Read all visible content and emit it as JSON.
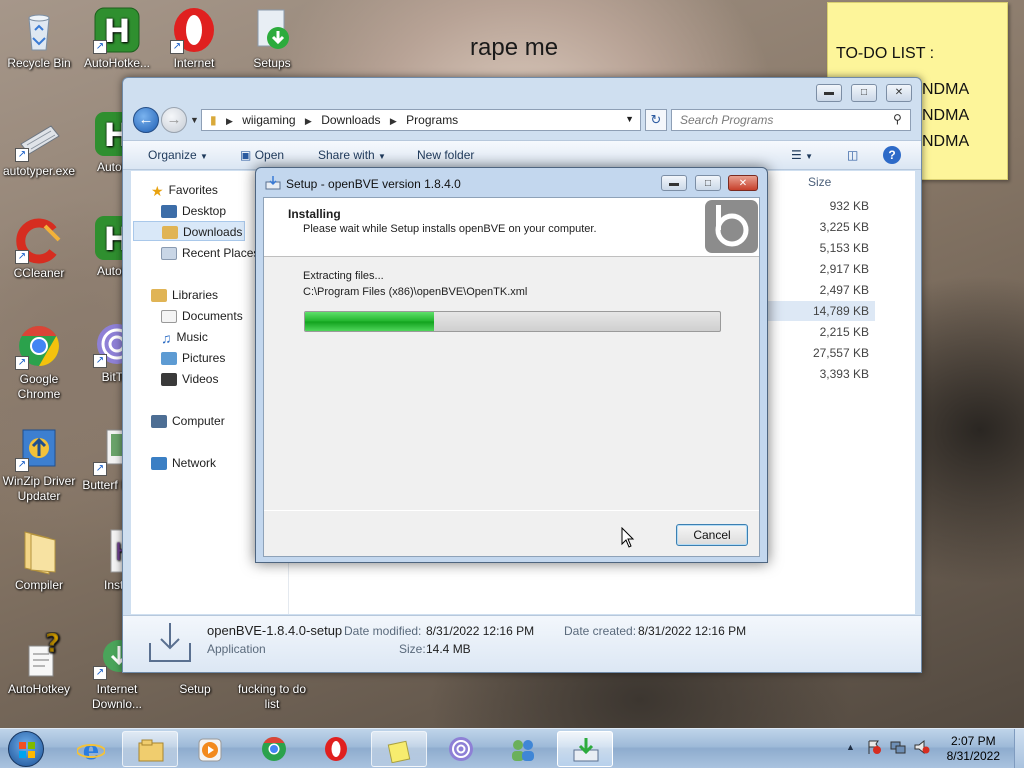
{
  "wallpaper_text": "rape me",
  "sticky_note": {
    "title": "TO-DO LIST :",
    "lines": [
      "NDMA",
      "NDMA",
      "NDMA"
    ]
  },
  "desktop_icons": [
    {
      "label": "Recycle Bin",
      "icon": "recycle-bin-icon"
    },
    {
      "label": "AutoHotke...",
      "icon": "autohotkey-icon"
    },
    {
      "label": "Internet",
      "icon": "opera-icon"
    },
    {
      "label": "Setups",
      "icon": "setups-icon"
    },
    {
      "label": "autotyper.exe",
      "icon": "keyboard-icon"
    },
    {
      "label": "AutoHo",
      "icon": "autohotkey-icon"
    },
    {
      "label": "CCleaner",
      "icon": "ccleaner-icon"
    },
    {
      "label": "AutoHo",
      "icon": "autohotkey-icon"
    },
    {
      "label": "Google Chrome",
      "icon": "chrome-icon"
    },
    {
      "label": "BitTor",
      "icon": "bittorrent-icon"
    },
    {
      "label": "WinZip Driver Updater",
      "icon": "winzip-icon"
    },
    {
      "label": "Butterf Deskt",
      "icon": "butterfly-icon"
    },
    {
      "label": "Compiler",
      "icon": "folder-icon"
    },
    {
      "label": "Insta",
      "icon": "installer-icon"
    },
    {
      "label": "AutoHotkey",
      "icon": "autohotkey-script-icon"
    },
    {
      "label": "Internet Downlo...",
      "icon": "idm-icon"
    },
    {
      "label": "Setup",
      "icon": "setup-icon"
    },
    {
      "label": "fucking to do list",
      "icon": "text-file-icon"
    }
  ],
  "explorer": {
    "breadcrumbs": [
      "wiigaming",
      "Downloads",
      "Programs"
    ],
    "search_placeholder": "Search Programs",
    "toolbar": {
      "organize": "Organize",
      "open": "Open",
      "share_with": "Share with",
      "new_folder": "New folder"
    },
    "nav": {
      "favorites": "Favorites",
      "favorite_items": [
        "Desktop",
        "Downloads",
        "Recent Places"
      ],
      "libraries": "Libraries",
      "library_items": [
        "Documents",
        "Music",
        "Pictures",
        "Videos"
      ],
      "computer": "Computer",
      "network": "Network"
    },
    "column_size": "Size",
    "sizes": [
      "932 KB",
      "3,225 KB",
      "5,153 KB",
      "2,917 KB",
      "2,497 KB",
      "14,789 KB",
      "2,215 KB",
      "27,557 KB",
      "3,393 KB"
    ],
    "details": {
      "name": "openBVE-1.8.4.0-setup",
      "type": "Application",
      "date_modified_label": "Date modified:",
      "date_modified": "8/31/2022 12:16 PM",
      "date_created_label": "Date created:",
      "date_created": "8/31/2022 12:16 PM",
      "size_label": "Size:",
      "size": "14.4 MB"
    }
  },
  "setup": {
    "title": "Setup - openBVE version 1.8.4.0",
    "heading": "Installing",
    "subheading": "Please wait while Setup installs openBVE on your computer.",
    "status": "Extracting files...",
    "file_path": "C:\\Program Files (x86)\\openBVE\\OpenTK.xml",
    "progress": 0.31,
    "cancel": "Cancel"
  },
  "clock": {
    "time": "2:07 PM",
    "date": "8/31/2022"
  }
}
